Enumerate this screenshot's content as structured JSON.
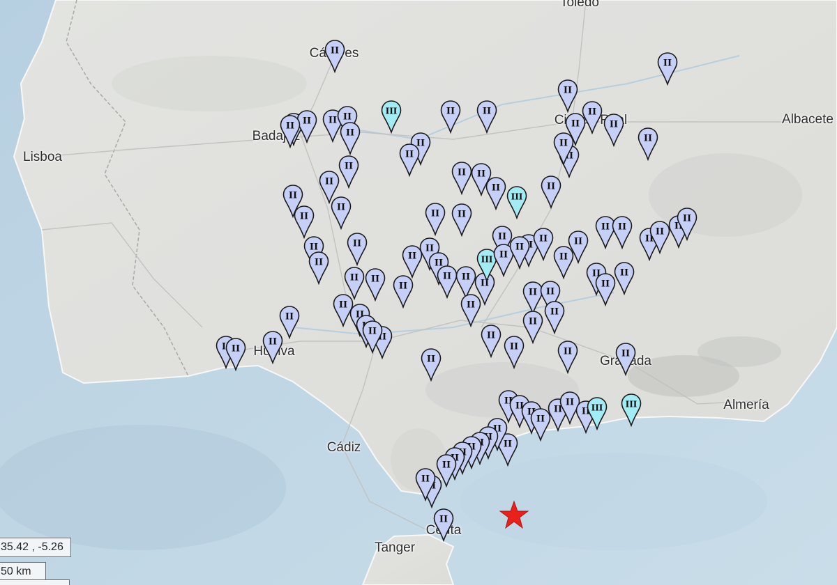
{
  "map": {
    "cities": [
      {
        "id": "toledo",
        "name": "Toledo"
      },
      {
        "id": "caceres",
        "name": "Cáceres"
      },
      {
        "id": "badajoz",
        "name": "Badajoz"
      },
      {
        "id": "lisboa",
        "name": "Lisboa"
      },
      {
        "id": "ciudad-real",
        "name": "Ciudad Real"
      },
      {
        "id": "albacete",
        "name": "Albacete"
      },
      {
        "id": "huelva",
        "name": "Huelva"
      },
      {
        "id": "granada",
        "name": "Granada"
      },
      {
        "id": "almeria",
        "name": "Almería"
      },
      {
        "id": "cadiz",
        "name": "Cádiz"
      },
      {
        "id": "ceuta",
        "name": "Ceuta"
      },
      {
        "id": "tanger",
        "name": "Tanger"
      }
    ],
    "intensity_colors": {
      "II": "#c6cff5",
      "III": "#a3ecf4"
    },
    "epicenter": {
      "icon": "star-icon",
      "color": "#e8211c"
    },
    "coordinates_readout": "35.42 , -5.26",
    "scale_label": "50 km"
  }
}
